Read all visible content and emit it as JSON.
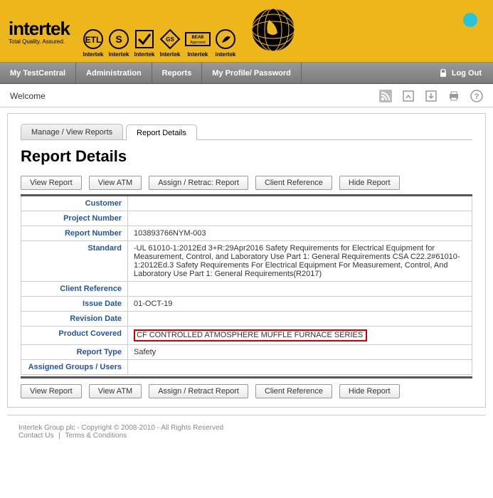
{
  "brand": {
    "name": "intertek",
    "tagline": "Total Quality. Assured."
  },
  "cert_labels": [
    "Intertek",
    "Intertek",
    "Intertek",
    "Intertek",
    "Intertek",
    "intertek"
  ],
  "nav": {
    "items": [
      "My TestCentral",
      "Administration",
      "Reports",
      "My Profile/ Password"
    ],
    "logout": "Log Out"
  },
  "subbar": {
    "welcome": "Welcome"
  },
  "tabs": {
    "manage": "Manage / View Reports",
    "details": "Report Details"
  },
  "title": "Report Details",
  "buttons": {
    "view_report": "View Report",
    "view_atm": "View ATM",
    "assign_top": "Assign / Retrac: Report",
    "assign_bottom": "Assign / Retract Report",
    "client_ref": "Client Reference",
    "hide": "Hide Report"
  },
  "fields": {
    "customer": {
      "label": "Customer",
      "value": ""
    },
    "project_number": {
      "label": "Project Number",
      "value": ""
    },
    "report_number": {
      "label": "Report Number",
      "value": "103893766NYM-003"
    },
    "standard": {
      "label": "Standard",
      "value": "-UL 61010-1:2012Ed 3+R:29Apr2016 Safety Requirements for Electrical Equipment for Measurement, Control, and Laboratory Use Part 1: General Requirements  CSA C22.2#61010-1:2012Ed.3 Safety Requirements For Electrical Equipment For Measurement, Control, And Laboratory Use Part 1: General Requirements(R2017)"
    },
    "client_reference": {
      "label": "Client Reference",
      "value": ""
    },
    "issue_date": {
      "label": "Issue Date",
      "value": "01-OCT-19"
    },
    "revision_date": {
      "label": "Revision Date",
      "value": ""
    },
    "product_covered": {
      "label": "Product Covered",
      "value": "CF CONTROLLED ATMOSPHERE MUFFLE FURNACE SERIES"
    },
    "report_type": {
      "label": "Report Type",
      "value": "Safety"
    },
    "assigned": {
      "label": "Assigned Groups / Users",
      "value": ""
    }
  },
  "footer": {
    "copyright": "Intertek Group plc - Copyright © 2008-2010 - All Rights Reserved",
    "contact": "Contact Us",
    "terms": "Terms & Conditions"
  }
}
